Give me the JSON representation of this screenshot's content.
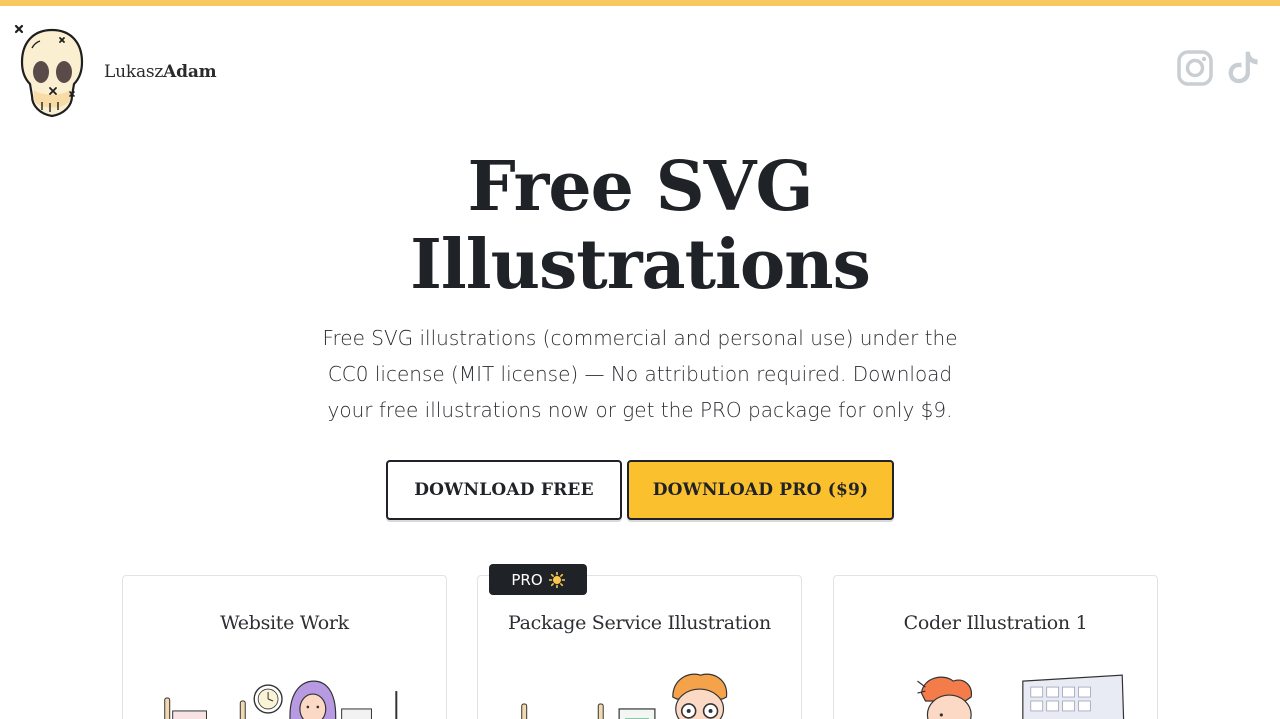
{
  "header": {
    "brand_first": "Lukasz",
    "brand_second": "Adam",
    "logo_icon": "skull-icon",
    "social": [
      {
        "name": "instagram-icon",
        "color": "#c9ced3"
      },
      {
        "name": "tiktok-icon",
        "color": "#c9ced3"
      }
    ]
  },
  "hero": {
    "title_line1": "Free SVG",
    "title_line2": "Illustrations",
    "description": "Free SVG illustrations (commercial and personal use) under the CC0 license (MIT license) — No attribution required. Download your free illustrations now or get the PRO package for only $9."
  },
  "buttons": {
    "download_free": "DOWNLOAD FREE",
    "download_pro": "DOWNLOAD PRO ($9)"
  },
  "cards": [
    {
      "title": "Website Work",
      "pro": false
    },
    {
      "title": "Package Service Illustration",
      "pro": true,
      "badge": "PRO"
    },
    {
      "title": "Coder Illustration 1",
      "pro": false
    }
  ],
  "colors": {
    "accent_bar": "#f6c85f",
    "pro_button": "#fbc02d",
    "text_dark": "#1f2328"
  }
}
